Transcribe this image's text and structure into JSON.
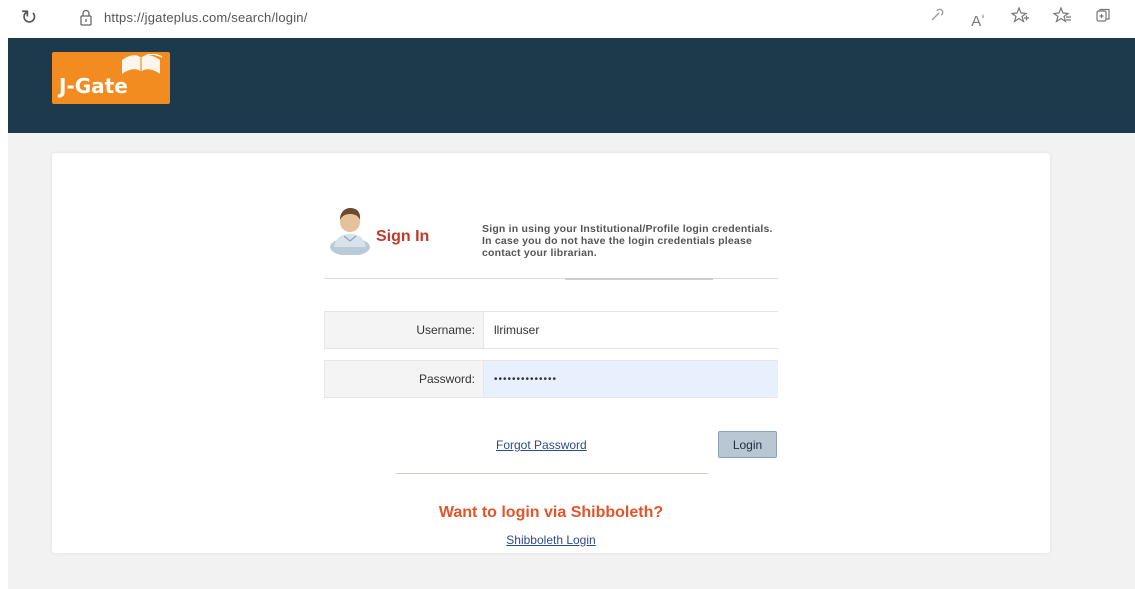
{
  "browser": {
    "url": "https://jgateplus.com/search/login/",
    "icons": [
      "reload-icon",
      "lock-icon",
      "extension-icon",
      "read-aloud-icon",
      "add-favorite-icon",
      "favorites-icon",
      "collections-icon"
    ]
  },
  "header": {
    "logo_text": "J-Gate",
    "background": "#1c3a4c",
    "logo_color": "#f28b20"
  },
  "signin": {
    "title": "Sign In",
    "description": "Sign in using your Institutional/Profile login credentials. In case you do not have the login credentials please contact your librarian.",
    "title_color": "#c0392b"
  },
  "form": {
    "username_label": "Username:",
    "username_value": "llrimuser",
    "password_label": "Password:",
    "password_value": "••••••••••••••",
    "forgot_label": "Forgot Password",
    "login_label": "Login"
  },
  "shibboleth": {
    "title": "Want to login via Shibboleth?",
    "link_label": "Shibboleth Login",
    "title_color": "#e2552b"
  }
}
